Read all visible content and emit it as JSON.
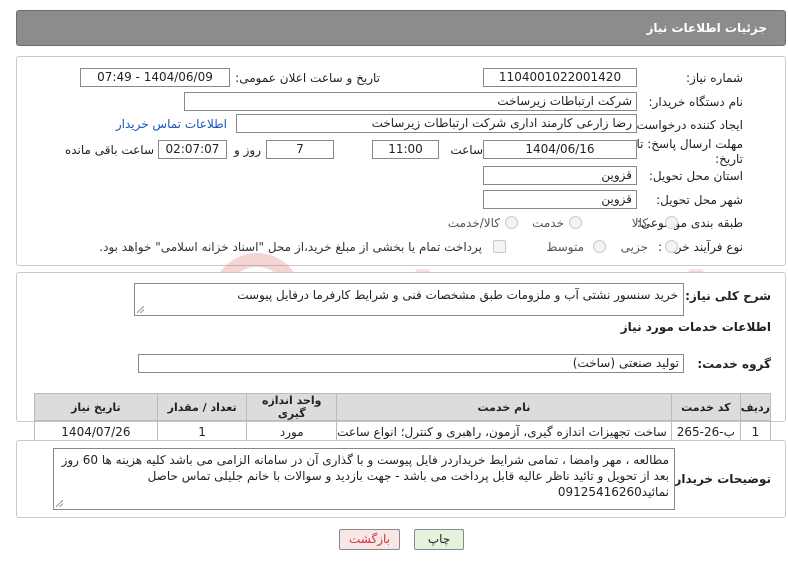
{
  "header": {
    "title": "جزئیات اطلاعات نیاز"
  },
  "form": {
    "need_number_label": "شماره نیاز:",
    "need_number": "1104001022001420",
    "announce_label": "تاریخ و ساعت اعلان عمومی:",
    "announce_value": "1404/06/09 - 07:49",
    "buyer_org_label": "نام دستگاه خریدار:",
    "buyer_org": "شرکت ارتباطات زیرساخت",
    "creator_label": "ایجاد کننده درخواست:",
    "creator": "رضا زارعی کارمند اداری شرکت ارتباطات زیرساخت",
    "contact_link": "اطلاعات تماس خریدار",
    "deadline_label_1": "مهلت ارسال پاسخ: تا",
    "deadline_label_2": "تاریخ:",
    "deadline_date": "1404/06/16",
    "time_label": "ساعت",
    "deadline_time": "11:00",
    "days_value": "7",
    "days_label": "روز و",
    "remaining_time": "02:07:07",
    "remaining_label": "ساعت باقی مانده",
    "province_label": "استان محل تحویل:",
    "province": "قزوین",
    "city_label": "شهر محل تحویل:",
    "city": "قزوین",
    "category_label": "طبقه بندی موضوعی:",
    "category_options": [
      "کالا",
      "خدمت",
      "کالا/خدمت"
    ],
    "process_label": "نوع فرآیند خرید :",
    "process_options": [
      "جزیی",
      "متوسط"
    ],
    "payment_note": "پرداخت تمام یا بخشی از مبلغ خرید،از محل \"اسناد خزانه اسلامی\" خواهد بود."
  },
  "summary": {
    "label": "شرح کلی نیاز:",
    "text": "خرید  سنسور نشتی آب و ملزومات طبق مشخصات فنی و شرایط کارفرما درفایل پیوست"
  },
  "services": {
    "section_title": "اطلاعات خدمات مورد نیاز",
    "group_label": "گروه خدمت:",
    "group_value": "تولید صنعتی (ساخت)",
    "columns": [
      "ردیف",
      "کد خدمت",
      "نام خدمت",
      "واحد اندازه گیری",
      "تعداد / مقدار",
      "تاریخ نیاز"
    ],
    "rows": [
      [
        "1",
        "ب-26-265",
        "ساخت تجهیزات اندازه گیری، آزمون، راهبری و کنترل؛ انواع ساعت",
        "مورد",
        "1",
        "1404/07/26"
      ]
    ]
  },
  "buyer_notes": {
    "label": "توضیحات خریدار:",
    "text": "مطالعه ، مهر وامضا ، تمامی شرایط خریداردر فایل پیوست و با گذاری آن در سامانه الزامی می باشد کلیه هزینه ها 60 روز بعد از تحویل و تائید ناظر عالیه قابل پرداخت می باشد - جهت بازدید و سوالات با خانم جلیلی تماس حاصل نمائید09125416260"
  },
  "buttons": {
    "print": "چاپ",
    "back": "بازگشت"
  },
  "watermark": {
    "text": "AriaTender.neT"
  },
  "colors": {
    "header_bg": "#8c8c8c",
    "link": "#1a56b8",
    "watermark": "#c94040"
  }
}
